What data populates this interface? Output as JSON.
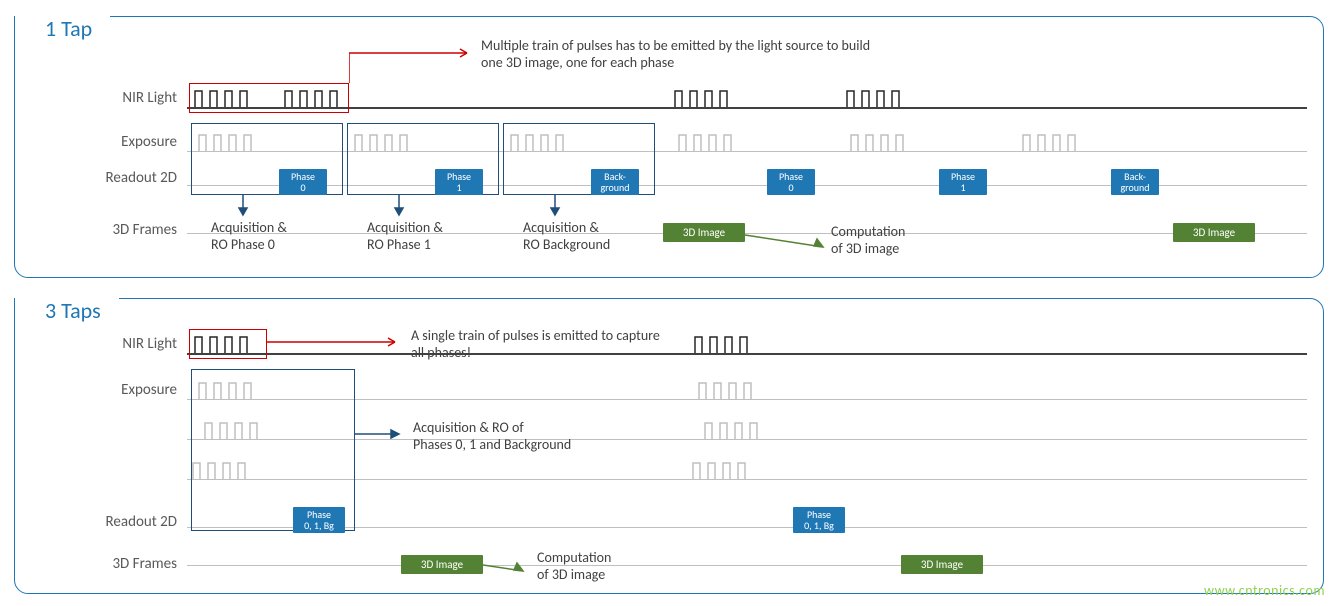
{
  "panel1": {
    "title": "1 Tap",
    "labels": {
      "nir": "NIR Light",
      "exposure": "Exposure",
      "readout": "Readout 2D",
      "frames": "3D Frames"
    },
    "callout": "Multiple train of pulses has to be emitted by the light source to build one 3D image, one for each phase",
    "phase0": "Phase\n0",
    "phase1": "Phase\n1",
    "bg": "Back-\nground",
    "acq0": "Acquisition &\nRO Phase 0",
    "acq1": "Acquisition &\nRO Phase 1",
    "acqbg": "Acquisition &\nRO Background",
    "img3d": "3D Image",
    "comp": "Computation\nof 3D image"
  },
  "panel2": {
    "title": "3 Taps",
    "labels": {
      "nir": "NIR Light",
      "exposure": "Exposure",
      "readout": "Readout 2D",
      "frames": "3D Frames"
    },
    "callout": "A single train of pulses is emitted to capture all phases!",
    "phase": "Phase\n0, 1, Bg",
    "acq": "Acquisition & RO of\nPhases 0, 1 and Background",
    "img3d": "3D Image",
    "comp": "Computation\nof 3D image"
  },
  "watermark": "www.cntronics.com"
}
